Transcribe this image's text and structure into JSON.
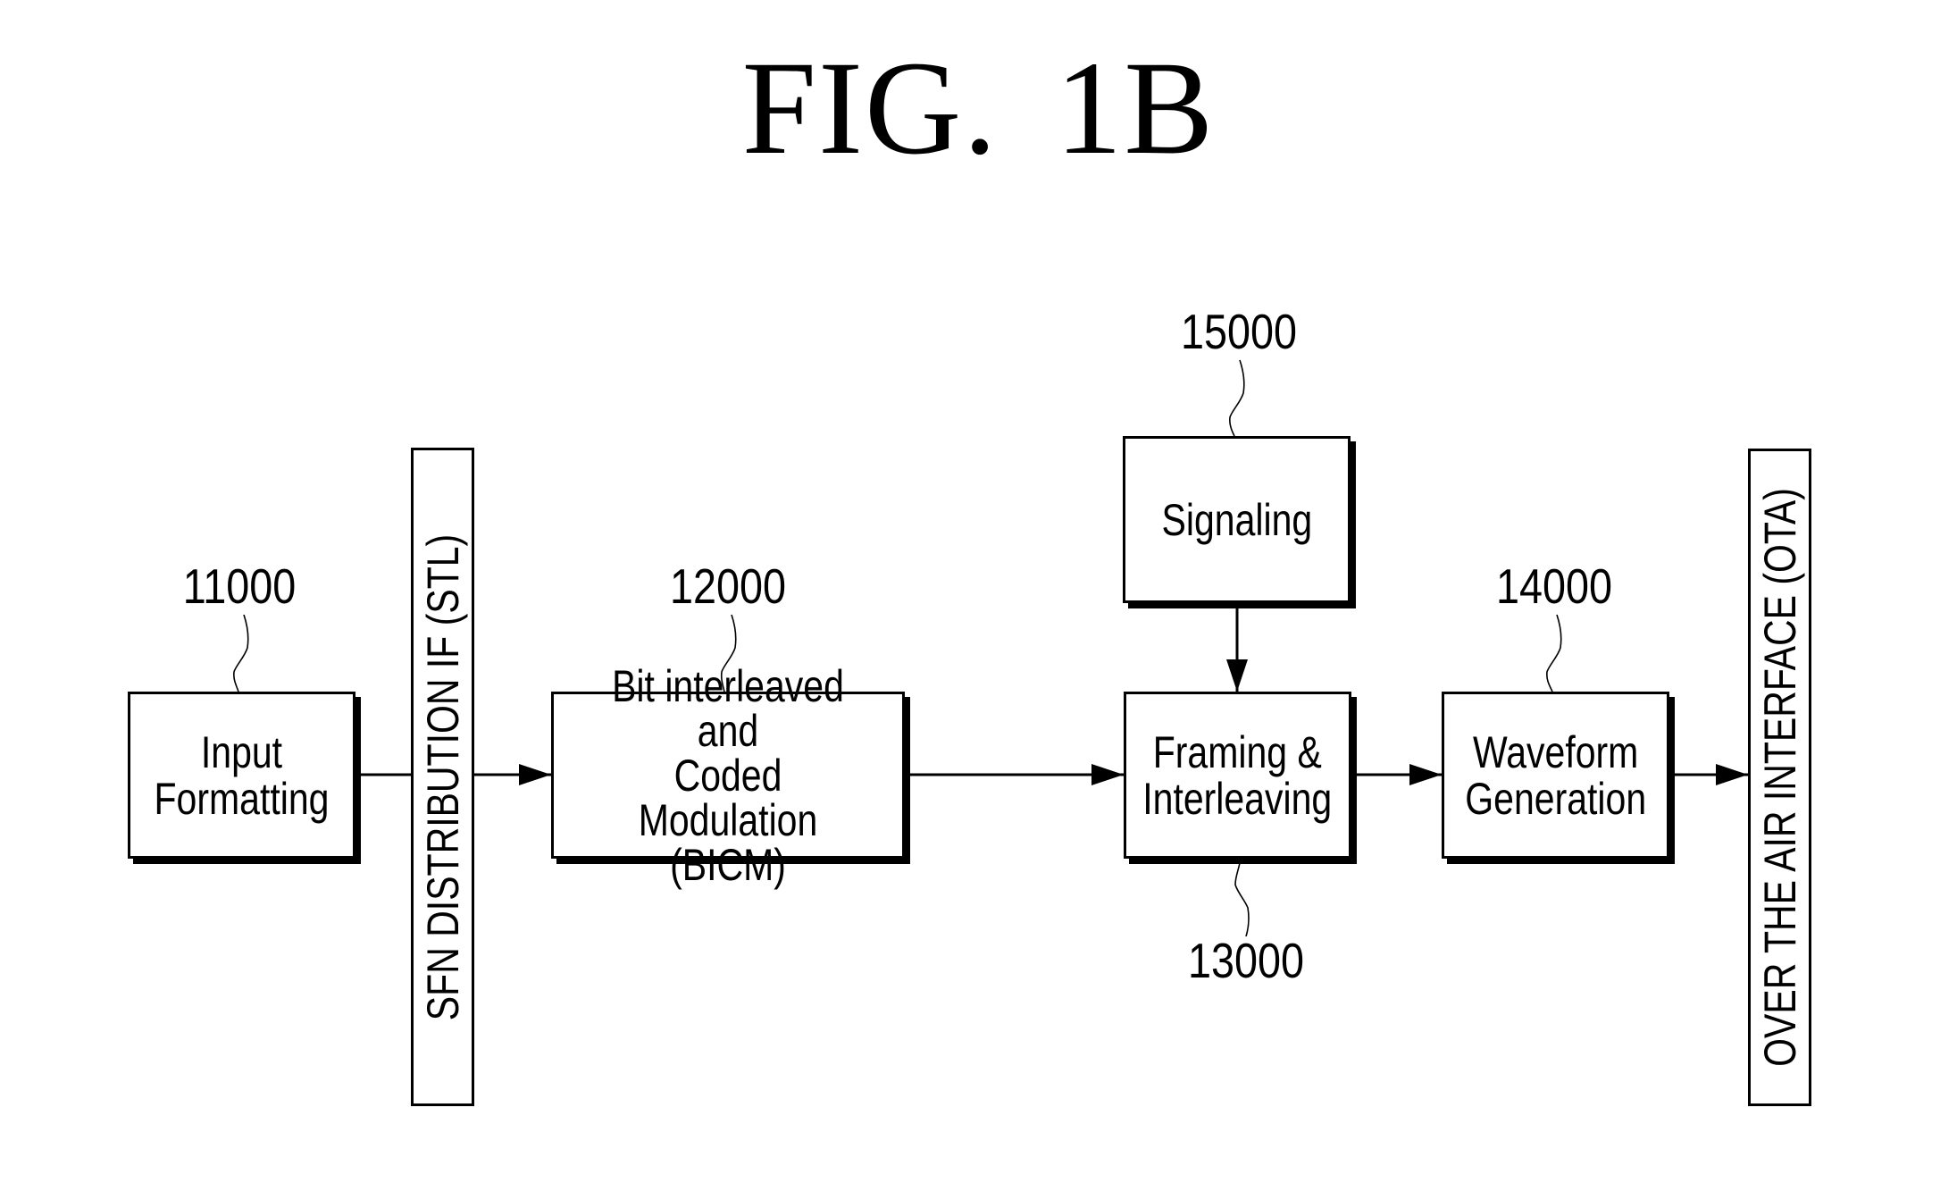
{
  "figure": {
    "title": "FIG.  1B"
  },
  "blocks": {
    "input_formatting": {
      "ref": "11000",
      "label": "Input\nFormatting"
    },
    "bicm": {
      "ref": "12000",
      "label": "Bit interleaved and\nCoded Modulation\n(BICM)"
    },
    "framing": {
      "ref": "13000",
      "label": "Framing &\nInterleaving"
    },
    "waveform": {
      "ref": "14000",
      "label": "Waveform\nGeneration"
    },
    "signaling": {
      "ref": "15000",
      "label": "Signaling"
    }
  },
  "interfaces": {
    "stl": "SFN DISTRIBUTION IF (STL)",
    "ota": "OVER THE AIR INTERFACE (OTA)"
  },
  "connections": [
    {
      "from": "Input Formatting",
      "to": "SFN DISTRIBUTION IF (STL)",
      "arrow": false
    },
    {
      "from": "SFN DISTRIBUTION IF (STL)",
      "to": "Bit interleaved and Coded Modulation (BICM)",
      "arrow": true
    },
    {
      "from": "Bit interleaved and Coded Modulation (BICM)",
      "to": "Framing & Interleaving",
      "arrow": true
    },
    {
      "from": "Signaling",
      "to": "Framing & Interleaving",
      "arrow": true
    },
    {
      "from": "Framing & Interleaving",
      "to": "Waveform Generation",
      "arrow": true
    },
    {
      "from": "Waveform Generation",
      "to": "OVER THE AIR INTERFACE (OTA)",
      "arrow": true
    }
  ]
}
